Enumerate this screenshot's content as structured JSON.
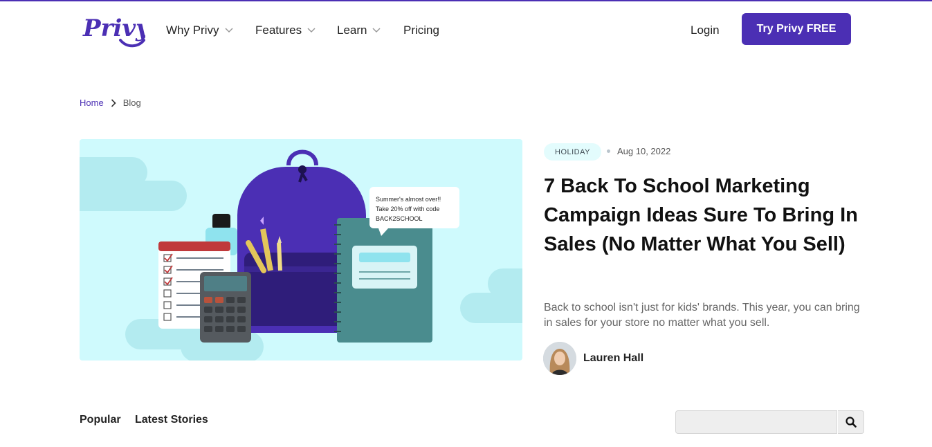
{
  "header": {
    "logo_text": "Privy",
    "nav": [
      {
        "label": "Why Privy",
        "has_dropdown": true
      },
      {
        "label": "Features",
        "has_dropdown": true
      },
      {
        "label": "Learn",
        "has_dropdown": true
      },
      {
        "label": "Pricing",
        "has_dropdown": false
      }
    ],
    "login_label": "Login",
    "cta_label": "Try Privy FREE"
  },
  "breadcrumb": {
    "home": "Home",
    "current": "Blog"
  },
  "featured": {
    "tag": "HOLIDAY",
    "date": "Aug 10, 2022",
    "title": "7 Back To School Marketing Campaign Ideas Sure To Bring In Sales (No Matter What You Sell)",
    "excerpt": "Back to school isn't just for kids' brands. This year, you can bring in sales for your store no matter what you sell.",
    "author": "Lauren Hall",
    "image": {
      "bubble_line1": "Summer's almost over!!",
      "bubble_line2": "Take 20% off with code",
      "bubble_line3": "BACK2SCHOOL"
    }
  },
  "tabs": [
    {
      "label": "Popular"
    },
    {
      "label": "Latest Stories"
    }
  ],
  "search": {
    "placeholder": "",
    "icon": "search-icon"
  },
  "colors": {
    "brand": "#4b2fb4",
    "hero_bg": "#cffafd",
    "tag_bg": "#e3fcfd"
  }
}
